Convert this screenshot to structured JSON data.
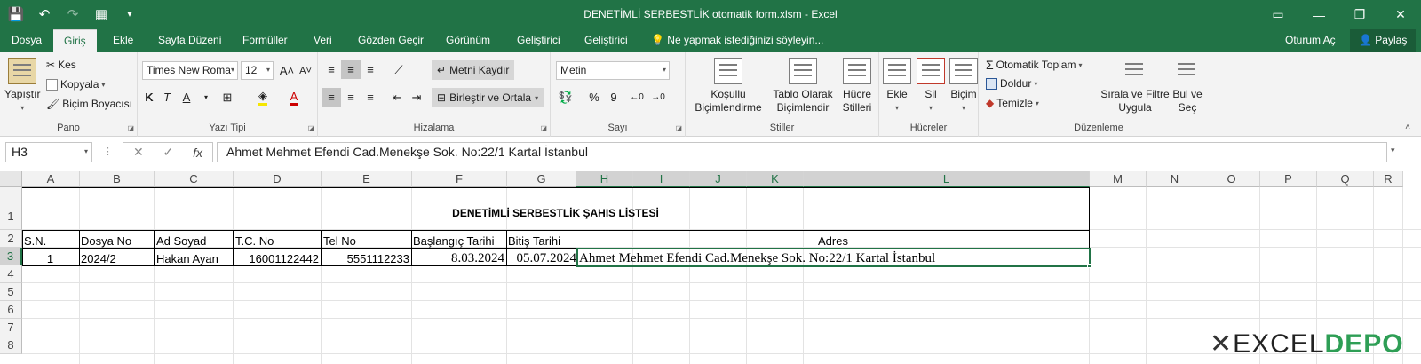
{
  "window": {
    "title": "DENETİMLİ SERBESTLİK otomatik form.xlsm - Excel",
    "sign_in": "Oturum Aç",
    "share": "Paylaş"
  },
  "tabs": [
    "Dosya",
    "Giriş",
    "Ekle",
    "Sayfa Düzeni",
    "Formüller",
    "Veri",
    "Gözden Geçir",
    "Görünüm",
    "Geliştirici",
    "Geliştirici"
  ],
  "tell_me": "Ne yapmak istediğinizi söyleyin...",
  "ribbon": {
    "clipboard": {
      "paste": "Yapıştır",
      "cut": "Kes",
      "copy": "Kopyala",
      "format_painter": "Biçim Boyacısı",
      "label": "Pano"
    },
    "font": {
      "name": "Times New Roma",
      "size": "12",
      "bold": "K",
      "italic": "T",
      "underline": "A",
      "label": "Yazı Tipi"
    },
    "alignment": {
      "wrap": "Metni Kaydır",
      "merge": "Birleştir ve Ortala",
      "label": "Hizalama"
    },
    "number": {
      "format": "Metin",
      "percent": "%",
      "comma": "9",
      "label": "Sayı"
    },
    "styles": {
      "conditional": "Koşullu\nBiçimlendirme",
      "table": "Tablo Olarak\nBiçimlendir",
      "cell": "Hücre\nStilleri",
      "label": "Stiller"
    },
    "cells": {
      "insert": "Ekle",
      "delete": "Sil",
      "format": "Biçim",
      "label": "Hücreler"
    },
    "editing": {
      "autosum": "Otomatik Toplam",
      "fill": "Doldur",
      "clear": "Temizle",
      "sort": "Sırala ve Filtre\nUygula",
      "find": "Bul ve\nSeç",
      "label": "Düzenleme"
    }
  },
  "formula_bar": {
    "name_box": "H3",
    "content": "Ahmet Mehmet Efendi Cad.Menekşe Sok. No:22/1 Kartal İstanbul"
  },
  "columns": [
    "A",
    "B",
    "C",
    "D",
    "E",
    "F",
    "G",
    "H",
    "I",
    "J",
    "K",
    "L",
    "M",
    "N",
    "O",
    "P",
    "Q",
    "R"
  ],
  "rows": [
    "1",
    "2",
    "3",
    "4",
    "5",
    "6",
    "7",
    "8"
  ],
  "sheet": {
    "title": "DENETİMLİ SERBESTLİK ŞAHIS LİSTESİ",
    "headers": [
      "S.N.",
      "Dosya No",
      "Ad Soyad",
      "T.C. No",
      "Tel No",
      "Başlangıç Tarihi",
      "Bitiş Tarihi",
      "Adres"
    ],
    "row3": [
      "1",
      "2024/2",
      "Hakan Ayan",
      "16001122442",
      "5551112233",
      "8.03.2024",
      "05.07.2024",
      "Ahmet Mehmet Efendi Cad.Menekşe Sok. No:22/1 Kartal İstanbul"
    ]
  },
  "watermark": {
    "text_a": "EXCEL",
    "text_b": "DEPO"
  }
}
